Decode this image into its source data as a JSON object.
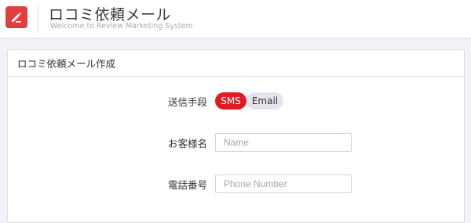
{
  "header": {
    "title": "ロコミ依頼メール",
    "subtitle": "Welcome to Review Marketing System",
    "logo_icon": "pencil-icon",
    "brand_color": "#e23d3f"
  },
  "card": {
    "title": "ロコミ依頼メール作成"
  },
  "form": {
    "method": {
      "label": "送信手段",
      "options": [
        "SMS",
        "Email"
      ],
      "selected": "SMS",
      "active_color": "#df1c22"
    },
    "customer_name": {
      "label": "お客様名",
      "placeholder": "Name",
      "value": ""
    },
    "phone": {
      "label": "電話番号",
      "placeholder": "Phone Number",
      "value": ""
    }
  }
}
